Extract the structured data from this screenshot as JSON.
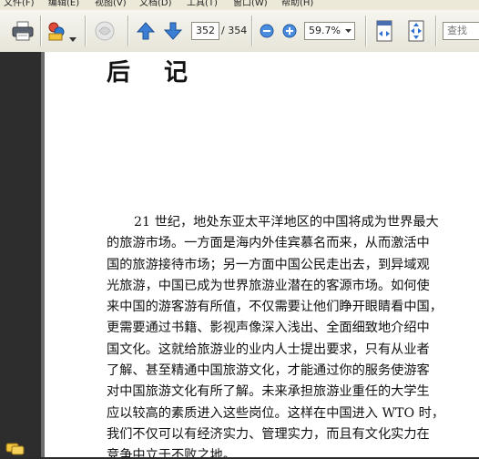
{
  "menu": {
    "items": [
      "文件(F)",
      "编辑(E)",
      "视图(V)",
      "文档(D)",
      "工具(T)",
      "窗口(W)",
      "帮助(H)"
    ]
  },
  "toolbar": {
    "current_page": "352",
    "total_pages": "/ 354",
    "zoom": "59.7%",
    "search_placeholder": "查找"
  },
  "document": {
    "heading": "后 记",
    "lines": [
      "21 世纪，地处东亚太平洋地区的中国将成为世界最大",
      "的旅游市场。一方面是海内外佳宾慕名而来，从而激活中",
      "国的旅游接待市场；另一方面中国公民走出去，到异域观",
      "光旅游，中国已成为世界旅游业潜在的客源市场。如何使",
      "来中国的游客游有所值，不仅需要让他们睁开眼睛看中国，",
      "更需要通过书籍、影视声像深入浅出、全面细致地介绍中",
      "国文化。这就给旅游业的业内人士提出要求，只有从业者",
      "了解、甚至精通中国旅游文化，才能通过你的服务使游客",
      "对中国旅游文化有所了解。未来承担旅游业重任的大学生",
      "应以较高的素质进入这些岗位。这样在中国进入 WTO 时，",
      "我们不仅可以有经济实力、管理实力，而且有文化实力在",
      "竞争中立于不败之地。"
    ]
  }
}
